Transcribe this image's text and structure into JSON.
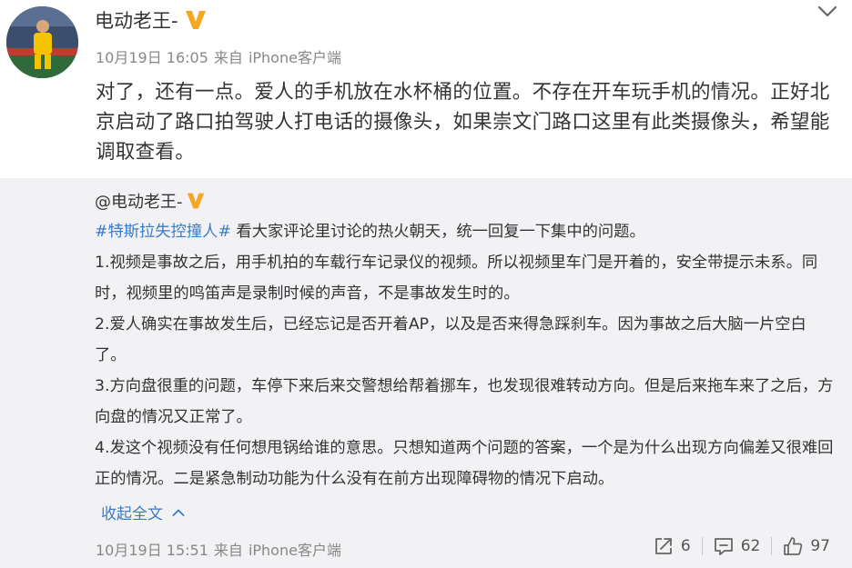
{
  "post": {
    "author": "电动老王-",
    "verified_icon": "verified-v-icon",
    "date": "10月19日 16:05",
    "source_prefix": "来自",
    "source": "iPhone客户端",
    "text": "对了，还有一点。爱人的手机放在水杯桶的位置。不存在开车玩手机的情况。正好北京启动了路口拍驾驶人打电话的摄像头，如果崇文门路口这里有此类摄像头，希望能调取查看。"
  },
  "repost": {
    "author": "@电动老王-",
    "hashtag": "#特斯拉失控撞人#",
    "intro": " 看大家评论里讨论的热火朝天，统一回复一下集中的问题。",
    "paragraphs": [
      "1.视频是事故之后，用手机拍的车载行车记录仪的视频。所以视频里车门是开着的，安全带提示未系。同时，视频里的鸣笛声是录制时候的声音，不是事故发生时的。",
      "2.爱人确实在事故发生后，已经忘记是否开着AP，以及是否来得急踩刹车。因为事故之后大脑一片空白了。",
      "3.方向盘很重的问题，车停下来后来交警想给帮着挪车，也发现很难转动方向。但是后来拖车来了之后，方向盘的情况又正常了。",
      "4.发这个视频没有任何想甩锅给谁的意思。只想知道两个问题的答案，一个是为什么出现方向偏差又很难回正的情况。二是紧急制动功能为什么没有在前方出现障碍物的情况下启动。"
    ],
    "collapse_label": "收起全文",
    "date": "10月19日 15:51",
    "source_prefix": "来自",
    "source": "iPhone客户端",
    "reposts": "6",
    "comments": "62",
    "likes": "97"
  },
  "colors": {
    "link": "#3a7bc8",
    "verified": "#f5a623",
    "repost_bg": "#f2f2f5"
  }
}
